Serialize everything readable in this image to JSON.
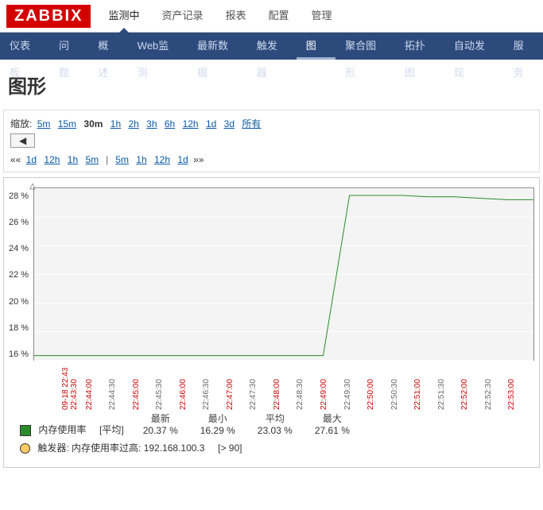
{
  "logo": "ZABBIX",
  "topnav": [
    "监测中",
    "资产记录",
    "报表",
    "配置",
    "管理"
  ],
  "topnav_active": 0,
  "subnav": [
    "仪表板",
    "问题",
    "概述",
    "Web监测",
    "最新数据",
    "触发器",
    "图形",
    "聚合图形",
    "拓扑图",
    "自动发现",
    "服务"
  ],
  "subnav_active": 6,
  "page_title": "图形",
  "zoom_label": "缩放:",
  "zoom_opts": [
    "5m",
    "15m",
    "30m",
    "1h",
    "2h",
    "3h",
    "6h",
    "12h",
    "1d",
    "3d",
    "所有"
  ],
  "zoom_active": 2,
  "arrow_glyph": "◀",
  "nav_prefix": "««",
  "nav_left": [
    "1d",
    "12h",
    "1h",
    "5m"
  ],
  "nav_sep": "|",
  "nav_right": [
    "5m",
    "1h",
    "12h",
    "1d"
  ],
  "nav_suffix": "»»",
  "chart_data": {
    "type": "line",
    "ylabel": "",
    "xlabel": "",
    "ylim": [
      16,
      28
    ],
    "yticks": [
      "28 %",
      "26 %",
      "24 %",
      "22 %",
      "20 %",
      "18 %",
      "16 %"
    ],
    "xticks": [
      {
        "t": "09-18 22:43\n22:43:30",
        "red": true,
        "first": true
      },
      {
        "t": "22:44:00",
        "red": true
      },
      {
        "t": "22:44:30"
      },
      {
        "t": "22:45:00",
        "red": true
      },
      {
        "t": "22:45:30"
      },
      {
        "t": "22:46:00",
        "red": true
      },
      {
        "t": "22:46:30"
      },
      {
        "t": "22:47:00",
        "red": true
      },
      {
        "t": "22:47:30"
      },
      {
        "t": "22:48:00",
        "red": true
      },
      {
        "t": "22:48:30"
      },
      {
        "t": "22:49:00",
        "red": true
      },
      {
        "t": "22:49:30"
      },
      {
        "t": "22:50:00",
        "red": true
      },
      {
        "t": "22:50:30"
      },
      {
        "t": "22:51:00",
        "red": true
      },
      {
        "t": "22:51:30"
      },
      {
        "t": "22:52:00",
        "red": true
      },
      {
        "t": "22:52:30"
      },
      {
        "t": "22:53:00",
        "red": true
      }
    ],
    "series": [
      {
        "name": "内存使用率",
        "values": [
          16.3,
          16.3,
          16.3,
          16.3,
          16.3,
          16.3,
          16.3,
          16.3,
          16.3,
          16.3,
          16.3,
          16.3,
          27.5,
          27.5,
          27.5,
          27.4,
          27.4,
          27.3,
          27.2,
          27.2
        ]
      }
    ],
    "color": "#2a8b2a"
  },
  "legend": {
    "name": "内存使用率",
    "agg": "[平均]",
    "stats": [
      {
        "h": "最新",
        "v": "20.37 %"
      },
      {
        "h": "最小",
        "v": "16.29 %"
      },
      {
        "h": "平均",
        "v": "23.03 %"
      },
      {
        "h": "最大",
        "v": "27.61 %"
      }
    ]
  },
  "trigger": {
    "label": "触发器:",
    "text": "内存使用率过高: 192.168.100.3",
    "cond": "[> 90]",
    "color": "#ffcc66"
  }
}
